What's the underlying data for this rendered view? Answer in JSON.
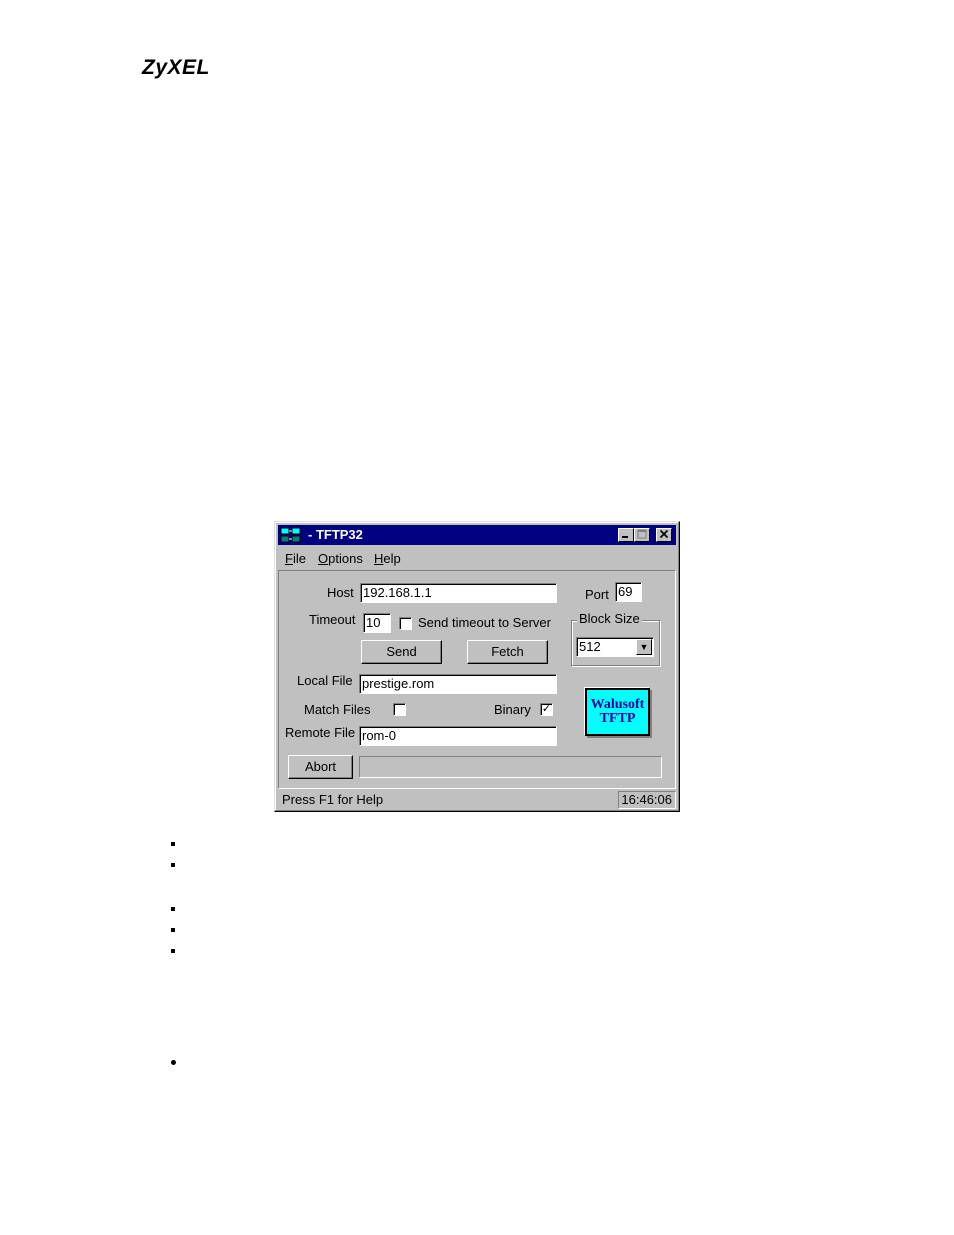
{
  "header": {
    "logo": "ZyXEL"
  },
  "window": {
    "title": "- TFTP32",
    "menu": [
      "File",
      "Options",
      "Help"
    ],
    "fields": {
      "host_label": "Host",
      "host_value": "192.168.1.1",
      "port_label": "Port",
      "port_value": "69",
      "timeout_label": "Timeout",
      "timeout_value": "10",
      "send_timeout_label": "Send timeout to Server",
      "block_size_label": "Block Size",
      "block_size_value": "512",
      "local_file_label": "Local File",
      "local_file_value": "prestige.rom",
      "match_files_label": "Match Files",
      "binary_label": "Binary",
      "binary_checked": "✓",
      "remote_file_label": "Remote File",
      "remote_file_value": "rom-0"
    },
    "buttons": {
      "send": "Send",
      "fetch": "Fetch",
      "abort": "Abort"
    },
    "logo_line1": "Walusoft",
    "logo_line2": "TFTP",
    "status": {
      "help": "Press F1 for Help",
      "time": "16:46:06"
    }
  },
  "icons": {
    "app": "network-icon",
    "minimize": "minimize-icon",
    "maximize": "maximize-icon",
    "close": "close-icon"
  }
}
